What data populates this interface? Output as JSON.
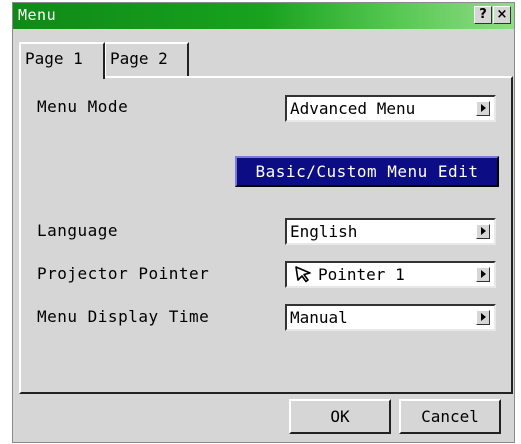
{
  "window": {
    "title": "Menu",
    "help_label": "?",
    "close_label": "×"
  },
  "tabs": [
    {
      "label": "Page 1",
      "active": true
    },
    {
      "label": "Page 2",
      "active": false
    }
  ],
  "settings": {
    "menu_mode": {
      "label": "Menu Mode",
      "value": "Advanced Menu"
    },
    "edit_button": "Basic/Custom Menu Edit",
    "language": {
      "label": "Language",
      "value": "English"
    },
    "projector_pointer": {
      "label": "Projector Pointer",
      "value": "Pointer 1",
      "icon": "pointer-arrow-icon"
    },
    "menu_display_time": {
      "label": "Menu Display Time",
      "value": "Manual"
    }
  },
  "buttons": {
    "ok": "OK",
    "cancel": "Cancel"
  },
  "colors": {
    "titlebar": "#18a21e",
    "edit_button_bg": "#0c0c84",
    "dialog_bg": "#d6d6d6"
  }
}
